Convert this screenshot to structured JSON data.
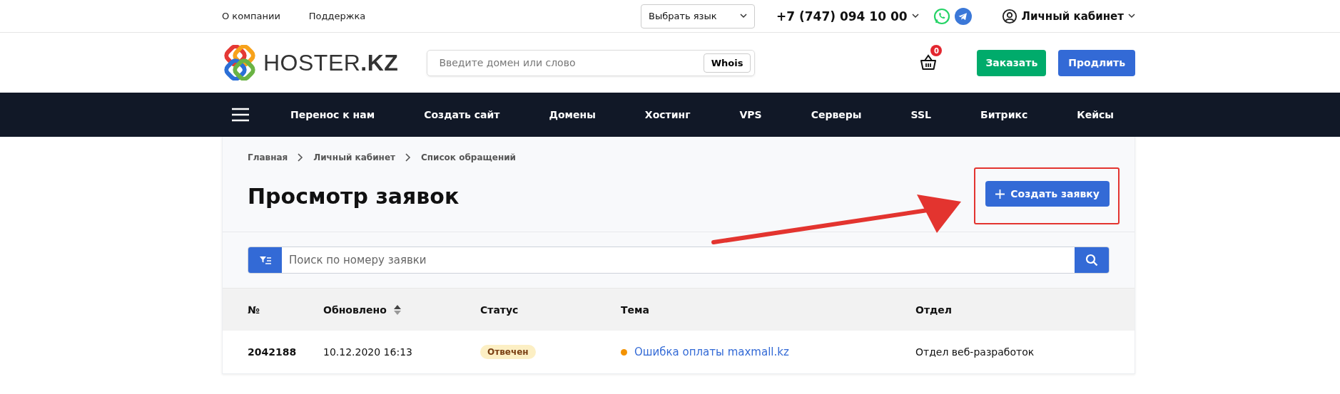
{
  "top_links": [
    "О компании",
    "Поддержка"
  ],
  "language_select": {
    "value": "Выбрать язык"
  },
  "phone": "+7 (747) 094 10 00",
  "account": "Личный кабинет",
  "logo": "HOSTER**.KZ**",
  "domain_search": {
    "placeholder": "Введите домен или слово",
    "button": "Whois"
  },
  "cart": {
    "count": "0"
  },
  "header_buttons": [
    {
      "label": "Заказать",
      "kind": "order"
    },
    {
      "label": "Продлить",
      "kind": "renew"
    }
  ],
  "nav": [
    "Перенос к нам",
    "Создать сайт",
    "Домены",
    "Хостинг",
    "VPS",
    "Серверы",
    "SSL",
    "Битрикс",
    "Кейсы"
  ],
  "breadcrumbs": [
    "Главная",
    "Личный кабинет",
    "Список обращений"
  ],
  "title": "Просмотр заявок",
  "create_button": "Создать заявку",
  "ticket_search": {
    "placeholder": "Поиск по номеру заявки"
  },
  "table": {
    "columns": [
      {
        "label": "№",
        "sortable": false
      },
      {
        "label": "Обновлено",
        "sortable": true
      },
      {
        "label": "Статус",
        "sortable": false
      },
      {
        "label": "Тема",
        "sortable": false
      },
      {
        "label": "Отдел",
        "sortable": false
      }
    ],
    "rows": [
      {
        "number": "2042188",
        "updated": "10.12.2020 16:13",
        "status": "Отвечен",
        "topic": "Ошибка оплаты maxmall.kz",
        "color": "#f39200",
        "department": "Отдел веб-разработок"
      }
    ]
  }
}
